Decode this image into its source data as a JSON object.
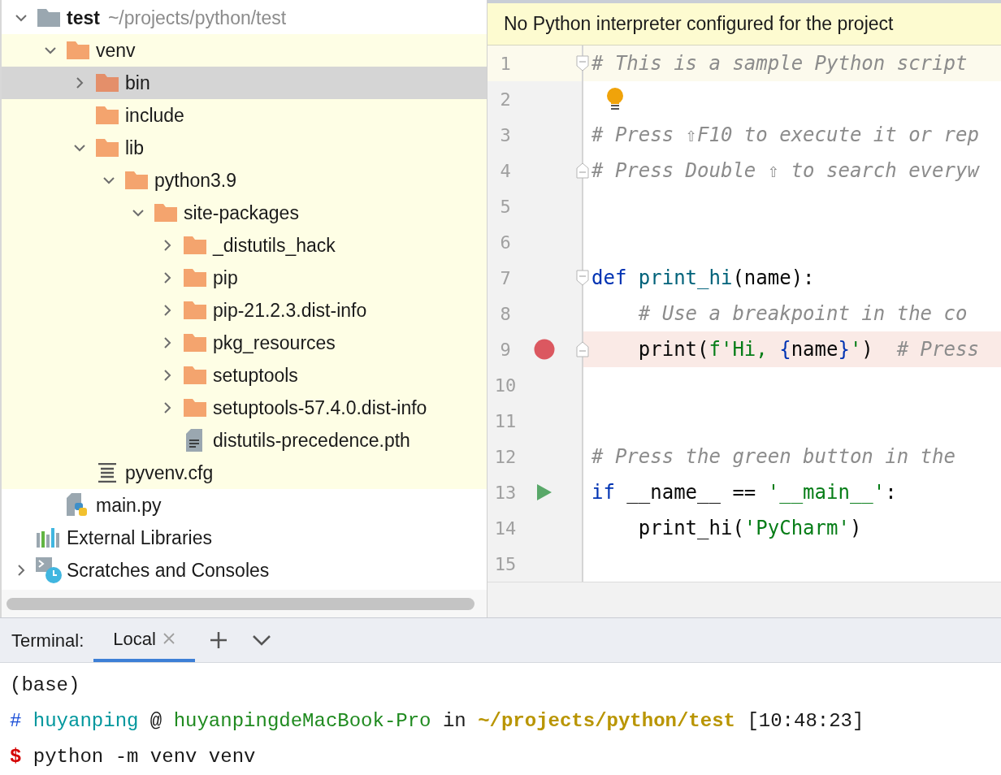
{
  "project_tree": {
    "items": [
      {
        "kind": "project",
        "name": "test",
        "path": "~/projects/python/test",
        "expanded": true,
        "selected": false,
        "excluded": false,
        "children": [
          {
            "kind": "folder",
            "name": "venv",
            "expanded": true,
            "selected": false,
            "excluded": true,
            "children": [
              {
                "kind": "folder",
                "name": "bin",
                "expanded": false,
                "selected": true,
                "excluded": true
              },
              {
                "kind": "folder",
                "name": "include",
                "selected": false,
                "excluded": true
              },
              {
                "kind": "folder",
                "name": "lib",
                "expanded": true,
                "selected": false,
                "excluded": true,
                "children": [
                  {
                    "kind": "folder",
                    "name": "python3.9",
                    "expanded": true,
                    "selected": false,
                    "excluded": true,
                    "children": [
                      {
                        "kind": "folder",
                        "name": "site-packages",
                        "expanded": true,
                        "selected": false,
                        "excluded": true,
                        "children": [
                          {
                            "kind": "folder",
                            "name": "_distutils_hack",
                            "expanded": false,
                            "selected": false,
                            "excluded": true
                          },
                          {
                            "kind": "folder",
                            "name": "pip",
                            "expanded": false,
                            "selected": false,
                            "excluded": true
                          },
                          {
                            "kind": "folder",
                            "name": "pip-21.2.3.dist-info",
                            "expanded": false,
                            "selected": false,
                            "excluded": true
                          },
                          {
                            "kind": "folder",
                            "name": "pkg_resources",
                            "expanded": false,
                            "selected": false,
                            "excluded": true
                          },
                          {
                            "kind": "folder",
                            "name": "setuptools",
                            "expanded": false,
                            "selected": false,
                            "excluded": true
                          },
                          {
                            "kind": "folder",
                            "name": "setuptools-57.4.0.dist-info",
                            "expanded": false,
                            "selected": false,
                            "excluded": true
                          },
                          {
                            "kind": "text",
                            "name": "distutils-precedence.pth",
                            "selected": false,
                            "excluded": true
                          }
                        ]
                      }
                    ]
                  }
                ]
              },
              {
                "kind": "config",
                "name": "pyvenv.cfg",
                "selected": false,
                "excluded": true
              }
            ]
          },
          {
            "kind": "python",
            "name": "main.py",
            "selected": false,
            "excluded": false
          }
        ]
      },
      {
        "kind": "libraries",
        "name": "External Libraries",
        "selected": false,
        "excluded": false
      },
      {
        "kind": "scratches",
        "name": "Scratches and Consoles",
        "expanded": false,
        "selected": false,
        "excluded": false
      }
    ]
  },
  "editor": {
    "banner": "No Python interpreter configured for the project",
    "lines": [
      {
        "number": "1",
        "kind": "plain",
        "current": true,
        "fold_start": true,
        "fold_end": false,
        "tokens": [
          {
            "kind": "comment",
            "text": "# This is a sample Python script"
          }
        ]
      },
      {
        "number": "2",
        "kind": "bulb",
        "current": false,
        "fold_start": false,
        "fold_end": false
      },
      {
        "number": "3",
        "kind": "plain",
        "current": false,
        "fold_start": false,
        "fold_end": false,
        "tokens": [
          {
            "kind": "comment",
            "text": "# Press ⇧F10 to execute it or rep"
          }
        ]
      },
      {
        "number": "4",
        "kind": "plain",
        "current": false,
        "fold_start": false,
        "fold_end": true,
        "tokens": [
          {
            "kind": "comment",
            "text": "# Press Double ⇧ to search everyw"
          }
        ]
      },
      {
        "number": "5",
        "kind": "plain",
        "current": false,
        "fold_start": false,
        "fold_end": false
      },
      {
        "number": "6",
        "kind": "plain",
        "current": false,
        "fold_start": false,
        "fold_end": false
      },
      {
        "number": "7",
        "kind": "plain",
        "current": false,
        "fold_start": true,
        "fold_end": false,
        "tokens": [
          {
            "kind": "keyword",
            "text": "def "
          },
          {
            "kind": "function",
            "text": "print_hi"
          },
          {
            "kind": "plain",
            "text": "(name):"
          }
        ]
      },
      {
        "number": "8",
        "kind": "plain",
        "current": false,
        "fold_start": false,
        "fold_end": false,
        "tokens": [
          {
            "kind": "comment",
            "text": "    # Use a breakpoint in the co"
          }
        ]
      },
      {
        "number": "9",
        "kind": "breakpoint",
        "current": false,
        "fold_start": false,
        "fold_end": true,
        "tokens": [
          {
            "kind": "plain",
            "text": "    print("
          },
          {
            "kind": "string",
            "text": "f'Hi, "
          },
          {
            "kind": "keyword",
            "text": "{"
          },
          {
            "kind": "plain",
            "text": "name"
          },
          {
            "kind": "keyword",
            "text": "}"
          },
          {
            "kind": "string",
            "text": "'"
          },
          {
            "kind": "plain",
            "text": ")  "
          },
          {
            "kind": "comment",
            "text": "# Press"
          }
        ]
      },
      {
        "number": "10",
        "kind": "plain",
        "current": false,
        "fold_start": false,
        "fold_end": false
      },
      {
        "number": "11",
        "kind": "plain",
        "current": false,
        "fold_start": false,
        "fold_end": false
      },
      {
        "number": "12",
        "kind": "plain",
        "current": false,
        "fold_start": false,
        "fold_end": false,
        "tokens": [
          {
            "kind": "comment",
            "text": "# Press the green button in the"
          }
        ]
      },
      {
        "number": "13",
        "kind": "run",
        "current": false,
        "fold_start": false,
        "fold_end": false,
        "tokens": [
          {
            "kind": "keyword",
            "text": "if "
          },
          {
            "kind": "plain",
            "text": "__name__ == "
          },
          {
            "kind": "string",
            "text": "'__main__'"
          },
          {
            "kind": "plain",
            "text": ":"
          }
        ]
      },
      {
        "number": "14",
        "kind": "plain",
        "current": false,
        "fold_start": false,
        "fold_end": false,
        "tokens": [
          {
            "kind": "plain",
            "text": "    print_hi("
          },
          {
            "kind": "string",
            "text": "'PyCharm'"
          },
          {
            "kind": "plain",
            "text": ")"
          }
        ]
      },
      {
        "number": "15",
        "kind": "plain",
        "current": false,
        "fold_start": false,
        "fold_end": false
      }
    ]
  },
  "terminal": {
    "label": "Terminal:",
    "tabs": [
      {
        "label": "Local",
        "selected": true
      }
    ],
    "lines": [
      [
        {
          "kind": "plain",
          "text": "(base)"
        }
      ],
      [
        {
          "kind": "hash",
          "text": "# "
        },
        {
          "kind": "user",
          "text": "huyanping"
        },
        {
          "kind": "plain",
          "text": " @ "
        },
        {
          "kind": "host",
          "text": "huyanpingdeMacBook-Pro"
        },
        {
          "kind": "plain",
          "text": " in "
        },
        {
          "kind": "path",
          "text": "~/projects/python/test"
        },
        {
          "kind": "plain",
          "text": " [10:48:23]"
        }
      ],
      [
        {
          "kind": "prompt",
          "text": "$"
        },
        {
          "kind": "plain",
          "text": " python -m venv venv"
        }
      ]
    ]
  }
}
